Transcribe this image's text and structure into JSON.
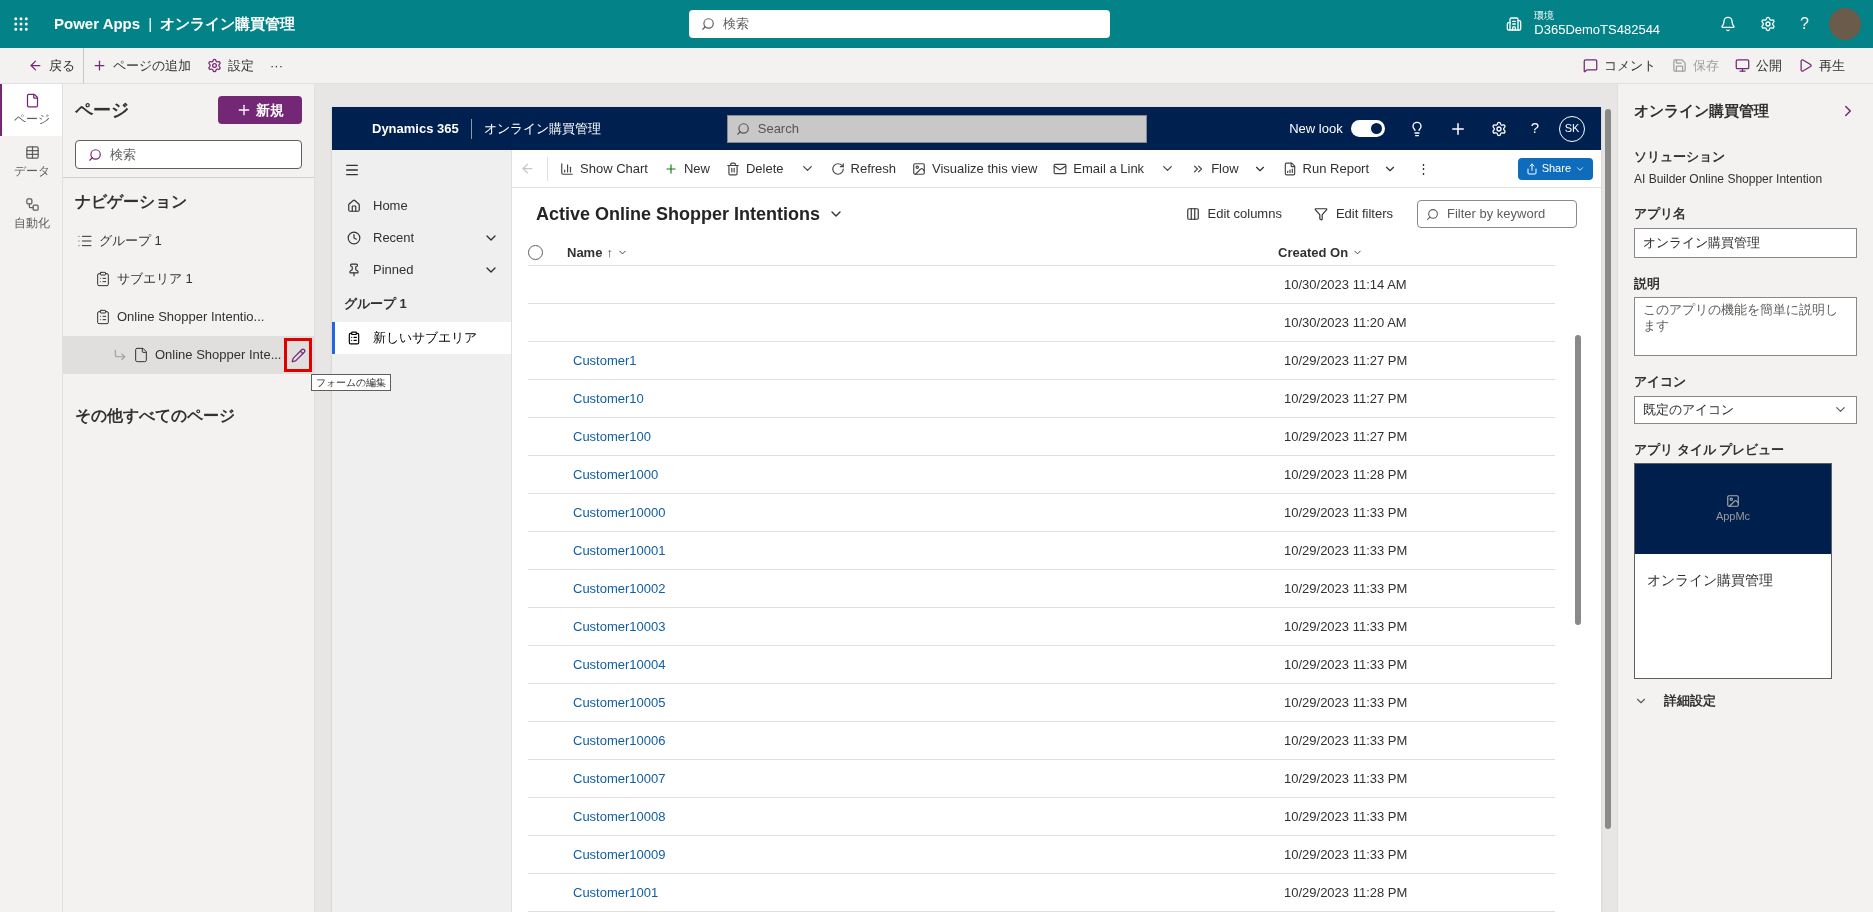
{
  "top_bar": {
    "product": "Power Apps",
    "separator": "|",
    "app_name": "オンライン購買管理",
    "search_placeholder": "検索",
    "environment_label": "環境",
    "environment_name": "D365DemoTS482544",
    "help": "?"
  },
  "command_bar": {
    "left": [
      {
        "kind": "back",
        "label": "戻る"
      },
      {
        "kind": "add",
        "label": "ページの追加"
      },
      {
        "kind": "settings",
        "label": "設定"
      },
      {
        "kind": "more",
        "label": "···"
      }
    ],
    "right": [
      {
        "kind": "comment",
        "label": "コメント",
        "disabled": false
      },
      {
        "kind": "save",
        "label": "保存",
        "disabled": true
      },
      {
        "kind": "publish",
        "label": "公開",
        "disabled": false
      },
      {
        "kind": "play",
        "label": "再生",
        "disabled": false
      }
    ]
  },
  "rail": [
    {
      "kind": "pages",
      "label": "ページ",
      "selected": true
    },
    {
      "kind": "data",
      "label": "データ",
      "selected": false
    },
    {
      "kind": "automate",
      "label": "自動化",
      "selected": false
    }
  ],
  "pages_panel": {
    "title": "ページ",
    "new_button": "新規",
    "search_placeholder": "検索",
    "navigation_heading": "ナビゲーション",
    "tree": [
      {
        "kind": "group",
        "label": "グループ 1",
        "selected": false,
        "children": [
          {
            "kind": "subarea",
            "label": "サブエリア 1",
            "selected": false
          },
          {
            "kind": "subarea",
            "label": "Online Shopper Intentio...",
            "selected": false,
            "children": [
              {
                "kind": "page",
                "label": "Online Shopper Inte...",
                "selected": true
              }
            ]
          }
        ]
      }
    ],
    "tooltip": "フォームの編集",
    "other_heading": "その他すべてのページ"
  },
  "preview": {
    "header": {
      "brand": "Dynamics 365",
      "app_name": "オンライン購買管理",
      "search_placeholder": "Search",
      "new_look_label": "New look",
      "new_look_on": true,
      "help": "?",
      "avatar": "SK"
    },
    "sitemap": [
      {
        "kind": "home",
        "label": "Home",
        "selected": false
      },
      {
        "kind": "recent",
        "label": "Recent",
        "selected": false
      },
      {
        "kind": "pinned",
        "label": "Pinned",
        "selected": false
      },
      {
        "kind": "group",
        "label": "グループ 1",
        "children": [
          {
            "kind": "subarea",
            "label": "新しいサブエリア",
            "selected": true
          }
        ]
      }
    ],
    "commands": [
      {
        "kind": "chart",
        "label": "Show Chart"
      },
      {
        "kind": "new",
        "label": "New"
      },
      {
        "kind": "delete",
        "label": "Delete"
      },
      {
        "kind": "split"
      },
      {
        "kind": "refresh",
        "label": "Refresh"
      },
      {
        "kind": "visualize",
        "label": "Visualize this view"
      },
      {
        "kind": "email",
        "label": "Email a Link"
      },
      {
        "kind": "split"
      },
      {
        "kind": "flow",
        "label": "Flow"
      },
      {
        "kind": "report",
        "label": "Run Report"
      },
      {
        "kind": "more",
        "label": "⋮"
      }
    ],
    "share": "Share",
    "view_title": "Active Online Shopper Intentions",
    "edit_columns": "Edit columns",
    "edit_filters": "Edit filters",
    "filter_placeholder": "Filter by keyword",
    "all_selected": false,
    "columns": [
      {
        "label": "Name",
        "sort": "↑"
      },
      {
        "label": "Created On"
      }
    ],
    "rows": [
      {
        "name": "",
        "created": "10/30/2023 11:14 AM"
      },
      {
        "name": "",
        "created": "10/30/2023 11:20 AM"
      },
      {
        "name": "Customer1",
        "created": "10/29/2023 11:27 PM"
      },
      {
        "name": "Customer10",
        "created": "10/29/2023 11:27 PM"
      },
      {
        "name": "Customer100",
        "created": "10/29/2023 11:27 PM"
      },
      {
        "name": "Customer1000",
        "created": "10/29/2023 11:28 PM"
      },
      {
        "name": "Customer10000",
        "created": "10/29/2023 11:33 PM"
      },
      {
        "name": "Customer10001",
        "created": "10/29/2023 11:33 PM"
      },
      {
        "name": "Customer10002",
        "created": "10/29/2023 11:33 PM"
      },
      {
        "name": "Customer10003",
        "created": "10/29/2023 11:33 PM"
      },
      {
        "name": "Customer10004",
        "created": "10/29/2023 11:33 PM"
      },
      {
        "name": "Customer10005",
        "created": "10/29/2023 11:33 PM"
      },
      {
        "name": "Customer10006",
        "created": "10/29/2023 11:33 PM"
      },
      {
        "name": "Customer10007",
        "created": "10/29/2023 11:33 PM"
      },
      {
        "name": "Customer10008",
        "created": "10/29/2023 11:33 PM"
      },
      {
        "name": "Customer10009",
        "created": "10/29/2023 11:33 PM"
      },
      {
        "name": "Customer1001",
        "created": "10/29/2023 11:28 PM"
      }
    ]
  },
  "properties": {
    "title": "オンライン購買管理",
    "solution_label": "ソリューション",
    "solution": "AI Builder Online Shopper Intention",
    "app_name_label": "アプリ名",
    "app_name": "オンライン購買管理",
    "description_label": "説明",
    "description_placeholder": "このアプリの機能を簡単に説明します",
    "icon_label": "アイコン",
    "icon_value": "既定のアイコン",
    "tile_label": "アプリ タイル プレビュー",
    "tile_image_alt": "AppMc",
    "tile_name": "オンライン購買管理",
    "advanced": "詳細設定"
  }
}
